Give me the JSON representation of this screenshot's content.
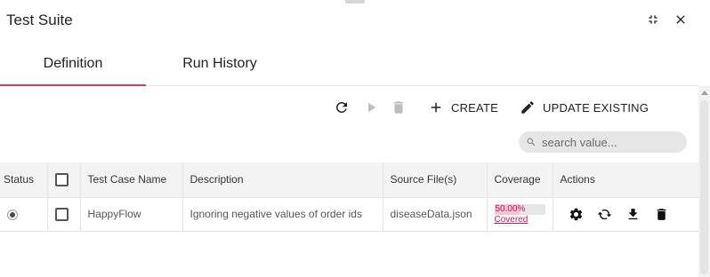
{
  "window": {
    "title": "Test Suite"
  },
  "tabs": [
    {
      "label": "Definition",
      "active": true
    },
    {
      "label": "Run History",
      "active": false
    }
  ],
  "toolbar": {
    "create_label": "CREATE",
    "update_label": "UPDATE EXISTING"
  },
  "search": {
    "placeholder": "search value..."
  },
  "colors": {
    "accent": "#e0336a",
    "coverage_text": "#c2185b",
    "coverage_fill": "#f2c4d4"
  },
  "table": {
    "columns": [
      "Status",
      "",
      "Test Case Name",
      "Description",
      "Source File(s)",
      "Coverage",
      "Actions"
    ],
    "rows": [
      {
        "name": "HappyFlow",
        "description": "Ignoring negative values of order ids",
        "source": "diseaseData.json",
        "coverage_pct": "50.00%",
        "coverage_fraction": 0.5,
        "coverage_link": "Covered"
      }
    ]
  }
}
